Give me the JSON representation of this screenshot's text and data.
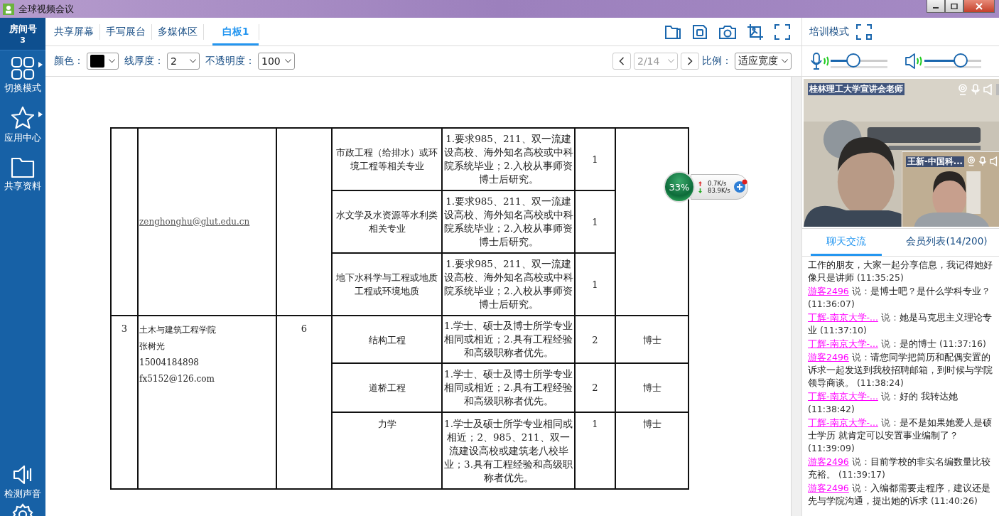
{
  "window": {
    "title": "全球视频会议"
  },
  "sidebar": {
    "room_label": "房间号",
    "room_number": "3",
    "items": [
      {
        "label": "切换模式",
        "kind": "grid",
        "has_arrow": true
      },
      {
        "label": "应用中心",
        "kind": "star",
        "has_arrow": true
      },
      {
        "label": "共享资料",
        "kind": "folder",
        "has_arrow": false
      }
    ],
    "bottom_items": [
      {
        "label": "检测声音",
        "kind": "speaker"
      }
    ]
  },
  "tabs": [
    {
      "label": "共享屏幕",
      "selected": false
    },
    {
      "label": "手写展台",
      "selected": false
    },
    {
      "label": "多媒体区",
      "selected": false
    },
    {
      "label": "白板1",
      "selected": true
    }
  ],
  "toolbar": {
    "color_label": "颜色：",
    "thickness_label": "线厚度：",
    "thickness": "2",
    "opacity_label": "不透明度：",
    "opacity": "100",
    "page": {
      "value": "2/14",
      "disabled": true
    },
    "scale_label": "比例：",
    "scale": "适应宽度"
  },
  "right_top": {
    "mode_label": "培训模式",
    "mic": {
      "level": 0.4
    },
    "speaker": {
      "level": 0.64
    }
  },
  "video": {
    "main_name": "桂林理工大学宣讲会老师",
    "pip_name": "王新-中国科..."
  },
  "network": {
    "percent": "33%",
    "up": "0.7K/s",
    "down": "83.9K/s"
  },
  "table": {
    "groups": [
      {
        "contact": [
          "zenghonghu@glut.edu.cn"
        ],
        "contact_link": true,
        "rows": [
          {
            "major": "市政工程（给排水）或环境工程等相关专业",
            "requirement": "1.要求985、211、双一流建设高校、海外知名高校或中科院系统毕业；2.入校从事师资博士后研究。",
            "num": "1"
          },
          {
            "major": "水文学及水资源等水利类相关专业",
            "requirement": "1.要求985、211、双一流建设高校、海外知名高校或中科院系统毕业；2.入校从事师资博士后研究。",
            "num": "1"
          },
          {
            "major": "地下水科学与工程或地质工程或环境地质",
            "requirement": "1.要求985、211、双一流建设高校、海外知名高校或中科院系统毕业；2.入校从事师资博士后研究。",
            "num": "1"
          }
        ]
      },
      {
        "col1": "3",
        "contact": [
          "土木与建筑工程学院",
          "张树光",
          "15004184898",
          "fx5152@126.com"
        ],
        "contact_link": false,
        "count": "6",
        "rows": [
          {
            "major": "结构工程",
            "requirement": "1.学士、硕士及博士所学专业相同或相近；2.具有工程经验和高级职称者优先。",
            "num": "2",
            "degree": "博士"
          },
          {
            "major": "道桥工程",
            "requirement": "1.学士、硕士及博士所学专业相同或相近；2.具有工程经验和高级职称者优先。",
            "num": "2",
            "degree": "博士"
          },
          {
            "major": "力学",
            "requirement": "1.学士及硕士所学专业相同或相近；2、985、211、双一流建设高校或建筑老八校毕业；3.具有工程经验和高级职称者优先。",
            "num": "1",
            "degree": "博士"
          }
        ]
      }
    ]
  },
  "chat_tabs": [
    {
      "label": "聊天交流",
      "selected": true
    },
    {
      "label": "会员列表(14/200)",
      "selected": false
    }
  ],
  "messages": [
    {
      "kind": "continuation",
      "text": "工作的朋友，大家一起分享信息，我记得她好像只是讲师",
      "time": "(11:35:25)"
    },
    {
      "kind": "message",
      "user": "游客2496",
      "said": "说：",
      "text": "是博士吧？是什么学科专业？",
      "time": "(11:36:07)"
    },
    {
      "kind": "message",
      "user": "丁辉-南京大学-...",
      "said": "说：",
      "text": "她是马克思主义理论专业",
      "time": "(11:37:10)"
    },
    {
      "kind": "message",
      "user": "丁辉-南京大学-...",
      "said": "说：",
      "text": "是的博士",
      "time": "(11:37:16)"
    },
    {
      "kind": "message",
      "user": "游客2496",
      "said": "说：",
      "text": "请您同学把简历和配偶安置的诉求一起发送到我校招聘邮箱，到时候与学院领导商谈。",
      "time": "(11:38:24)"
    },
    {
      "kind": "message",
      "user": "丁辉-南京大学-...",
      "said": "说：",
      "text": "好的 我转达她",
      "time": "(11:38:42)"
    },
    {
      "kind": "message",
      "user": "丁辉-南京大学-...",
      "said": "说：",
      "text": "是不是如果她爱人是硕士学历 就肯定可以安置事业编制了？",
      "time": "(11:39:09)"
    },
    {
      "kind": "message",
      "user": "游客2496",
      "said": "说：",
      "text": "目前学校的非实名编数量比较充裕。",
      "time": "(11:39:17)"
    },
    {
      "kind": "message",
      "user": "游客2496",
      "said": "说：",
      "text": "入编都需要走程序，建议还是先与学院沟通，提出她的诉求",
      "time": "(11:40:26)"
    }
  ]
}
